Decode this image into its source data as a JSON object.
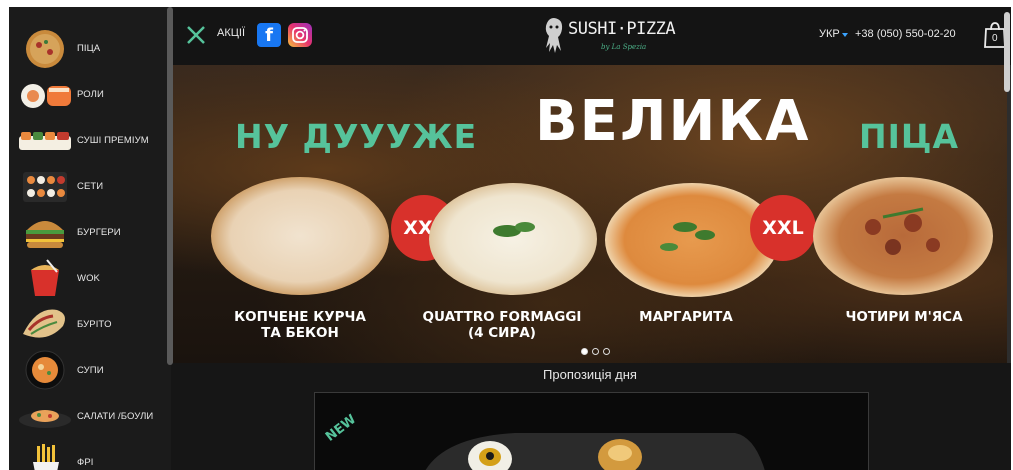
{
  "sidebar": {
    "items": [
      {
        "label": "Піца",
        "icon": "pizza-icon"
      },
      {
        "label": "Роли",
        "icon": "rolls-icon"
      },
      {
        "label": "Суші преміум",
        "icon": "sushi-premium-icon"
      },
      {
        "label": "Сети",
        "icon": "sets-icon"
      },
      {
        "label": "Бургери",
        "icon": "burger-icon"
      },
      {
        "label": "Wok",
        "icon": "wok-icon"
      },
      {
        "label": "Бурito",
        "icon": "burrito-icon"
      },
      {
        "label": "Супи",
        "icon": "soup-icon"
      },
      {
        "label": "Салати /Боули",
        "icon": "salad-icon"
      },
      {
        "label": "Фрі",
        "icon": "fries-icon"
      }
    ]
  },
  "header": {
    "promo_label": "АКЦІЇ",
    "logo_text": "SUSHI·PIZZA",
    "logo_sub": "by La Spezia",
    "lang": "УКР",
    "phone": "+38 (050) 550-02-20",
    "cart_count": "0",
    "colors": {
      "accent": "#56c39b",
      "facebook": "#1877f2"
    }
  },
  "banner": {
    "headline_left": "НУ ДУУУЖЕ",
    "headline_center": "ВЕЛИКА",
    "headline_right": "ПІЦА",
    "badge": "XXL",
    "pizzas": [
      {
        "line1": "КОПЧЕНЕ КУРЧА",
        "line2": "ТА БЕКОН"
      },
      {
        "line1": "QUATTRO FORMAGGI",
        "line2": "(4 СИРА)"
      },
      {
        "line1": "МАРГАРИТА",
        "line2": ""
      },
      {
        "line1": "ЧОТИРИ М'ЯСА",
        "line2": ""
      }
    ],
    "active_slide": 1,
    "slide_count": 3
  },
  "offer": {
    "title": "Пропозиція дня",
    "badge": "NEW"
  }
}
